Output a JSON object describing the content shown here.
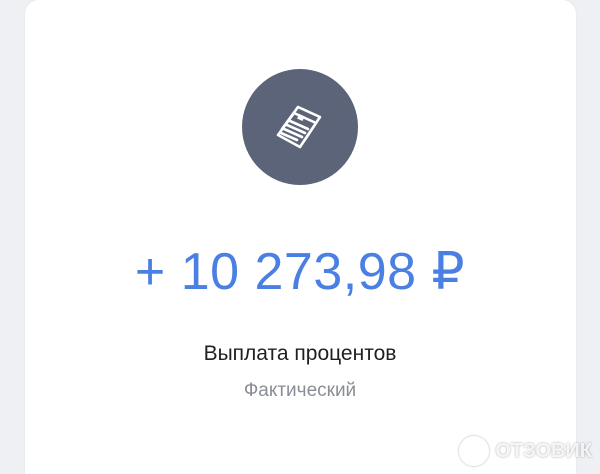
{
  "operation": {
    "amount": "+ 10 273,98 ₽",
    "title": "Выплата процентов",
    "status": "Фактический",
    "icon": "banknotes-icon",
    "icon_bg_color": "#5b6478",
    "amount_color": "#4a7fe3"
  },
  "watermark": {
    "text": "ОТЗОВИК"
  }
}
